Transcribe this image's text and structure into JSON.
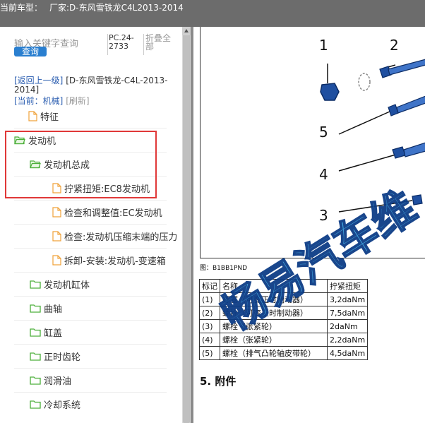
{
  "titlebar": {
    "label": "当前车型：",
    "vehicle": "厂家:D-东风雪铁龙C4L2013-2014"
  },
  "search": {
    "placeholder": "输入关键字查询",
    "query_button": "查询",
    "pc_label": "PC.24-2733",
    "collapse_all": "折叠全部"
  },
  "nav": {
    "back": "[返回上一级]",
    "path": "[D-东风雪铁龙-C4L-2013-2014]",
    "current": "[当前：机械]",
    "refresh": "[刷新]"
  },
  "tree": [
    {
      "label": "特征",
      "type": "file"
    },
    {
      "label": "发动机",
      "type": "folder"
    },
    {
      "label": "发动机总成",
      "type": "folder"
    },
    {
      "label": "拧紧扭矩:EC8发动机",
      "type": "file"
    },
    {
      "label": "检查和调整值:EC发动机",
      "type": "file"
    },
    {
      "label": "检查:发动机压缩末端的压力",
      "type": "file"
    },
    {
      "label": "拆卸-安装:发动机-变速箱",
      "type": "file"
    },
    {
      "label": "发动机缸体",
      "type": "folder"
    },
    {
      "label": "曲轴",
      "type": "folder"
    },
    {
      "label": "缸盖",
      "type": "folder"
    },
    {
      "label": "正时齿轮",
      "type": "folder"
    },
    {
      "label": "润滑油",
      "type": "folder"
    },
    {
      "label": "冷却系统",
      "type": "folder"
    }
  ],
  "diagram": {
    "callouts": [
      "1",
      "2",
      "5",
      "4",
      "3"
    ],
    "caption": "图：B1BB1PND"
  },
  "torque_table": {
    "headers": [
      "标记",
      "名称",
      "拧紧扭矩"
    ],
    "rows": [
      [
        "(1)",
        "螺塞（可变正时制动器）",
        "3,2daNm"
      ],
      [
        "(2)",
        "螺栓（可变正时制动器）",
        "7,5daNm"
      ],
      [
        "(3)",
        "螺栓（张紧轮）",
        "2daNm"
      ],
      [
        "(4)",
        "螺栓（张紧轮）",
        "2,2daNm"
      ],
      [
        "(5)",
        "螺栓（排气凸轮轴皮带轮）",
        "4,5daNm"
      ]
    ]
  },
  "section": {
    "title": "5. 附件"
  },
  "watermark": "畅易汽车维",
  "colors": {
    "titlebar": "#6c6c6c",
    "accent": "#2a7fd0",
    "highlight": "#e03838",
    "folder": "#4caf3a",
    "file": "#f0a23a"
  }
}
